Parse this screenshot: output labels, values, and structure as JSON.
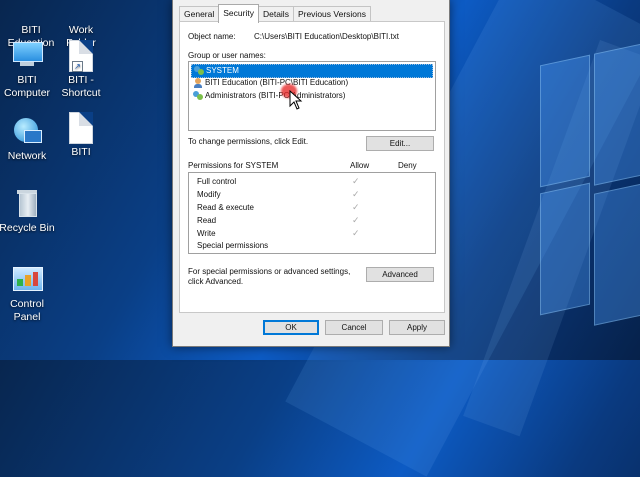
{
  "desktop": {
    "icons": [
      {
        "label": "BITI Education",
        "icon": "folder-icon"
      },
      {
        "label": "Work Folder",
        "icon": "folder-icon"
      },
      {
        "label": "BITI Computer",
        "icon": "computer-icon"
      },
      {
        "label": "BITI - Shortcut",
        "icon": "document-shortcut-icon"
      },
      {
        "label": "Network",
        "icon": "network-icon"
      },
      {
        "label": "BITI",
        "icon": "document-icon"
      },
      {
        "label": "Recycle Bin",
        "icon": "recycle-bin-icon"
      },
      {
        "label": "Control Panel",
        "icon": "control-panel-icon"
      }
    ]
  },
  "dialog": {
    "tabs": [
      {
        "label": "General"
      },
      {
        "label": "Security"
      },
      {
        "label": "Details"
      },
      {
        "label": "Previous Versions"
      }
    ],
    "active_tab": "Security",
    "object_name_label": "Object name:",
    "object_name_value": "C:\\Users\\BITI Education\\Desktop\\BITI.txt",
    "group_label": "Group or user names:",
    "users": [
      {
        "name": "SYSTEM",
        "selected": true
      },
      {
        "name": "BITI Education (BITI-PC\\BITI Education)",
        "selected": false
      },
      {
        "name": "Administrators (BITI-PC\\Administrators)",
        "selected": false
      }
    ],
    "change_perm_text": "To change permissions, click Edit.",
    "edit_button": "Edit...",
    "permissions_header": "Permissions for SYSTEM",
    "allow_header": "Allow",
    "deny_header": "Deny",
    "permissions": [
      {
        "name": "Full control",
        "allow": "✓",
        "deny": ""
      },
      {
        "name": "Modify",
        "allow": "✓",
        "deny": ""
      },
      {
        "name": "Read & execute",
        "allow": "✓",
        "deny": ""
      },
      {
        "name": "Read",
        "allow": "✓",
        "deny": ""
      },
      {
        "name": "Write",
        "allow": "✓",
        "deny": ""
      },
      {
        "name": "Special permissions",
        "allow": "",
        "deny": ""
      }
    ],
    "special_text_1": "For special permissions or advanced settings,",
    "special_text_2": "click Advanced.",
    "advanced_button": "Advanced",
    "ok_button": "OK",
    "cancel_button": "Cancel",
    "apply_button": "Apply"
  },
  "colors": {
    "selection": "#0078d7",
    "desktop_blue": "#0a3f86"
  }
}
